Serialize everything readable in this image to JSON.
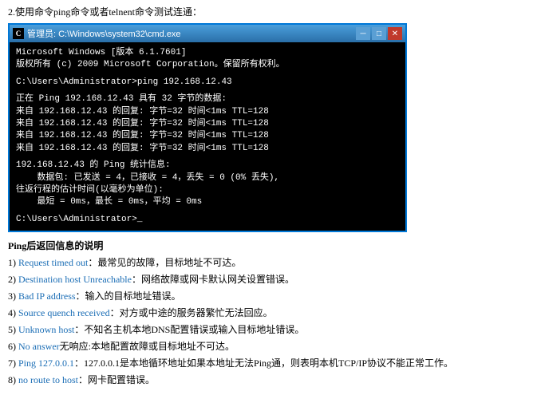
{
  "top_instruction": "2.使用命令ping命令或者telnent命令测试连通：",
  "cmd_window": {
    "title": "管理员: C:\\Windows\\system32\\cmd.exe",
    "lines": [
      "Microsoft Windows [版本 6.1.7601]",
      "版权所有 (c) 2009 Microsoft Corporation。保留所有权利。",
      "",
      "C:\\Users\\Administrator>ping 192.168.12.43",
      "",
      "正在 Ping 192.168.12.43 具有 32 字节的数据:",
      "来自 192.168.12.43 的回复: 字节=32 时间<1ms TTL=128",
      "来自 192.168.12.43 的回复: 字节=32 时间<1ms TTL=128",
      "来自 192.168.12.43 的回复: 字节=32 时间<1ms TTL=128",
      "来自 192.168.12.43 的回复: 字节=32 时间<1ms TTL=128",
      "",
      "192.168.12.43 的 Ping 统计信息:",
      "    数据包: 已发送 = 4，已接收 = 4，丢失 = 0 (0% 丢失),",
      "往返行程的估计时间(以毫秒为单位):",
      "    最短 = 0ms，最长 = 0ms，平均 = 0ms",
      "",
      "C:\\Users\\Administrator>_"
    ]
  },
  "ping_section": {
    "title": "Ping后返回信息的说明",
    "items": [
      {
        "number": "1)",
        "label": "Request timed out",
        "text": "：最常见的故障，目标地址不可达。"
      },
      {
        "number": "2)",
        "label": "Destination host Unreachable",
        "text": "：网络故障或网卡默认网关设置错误。"
      },
      {
        "number": "3)",
        "label": "Bad IP address",
        "text": "：输入的目标地址错误。"
      },
      {
        "number": "4)",
        "label": "Source quench received",
        "text": "：对方或中途的服务器繁忙无法回应。"
      },
      {
        "number": "5)",
        "label": "Unknown host",
        "text": "：不知名主机本地DNS配置错误或输入目标地址错误。"
      },
      {
        "number": "6)",
        "label": "No answer",
        "text": "无响应:本地配置故障或目标地址不可达。"
      },
      {
        "number": "7)",
        "label": "Ping 127.0.0.1",
        "text": "：127.0.0.1是本地循环地址如果本地址无法Ping通，则表明本机TCP/IP协议不能正常工作。"
      },
      {
        "number": "8)",
        "label": "no route to host",
        "text": "：网卡配置错误。"
      }
    ]
  }
}
